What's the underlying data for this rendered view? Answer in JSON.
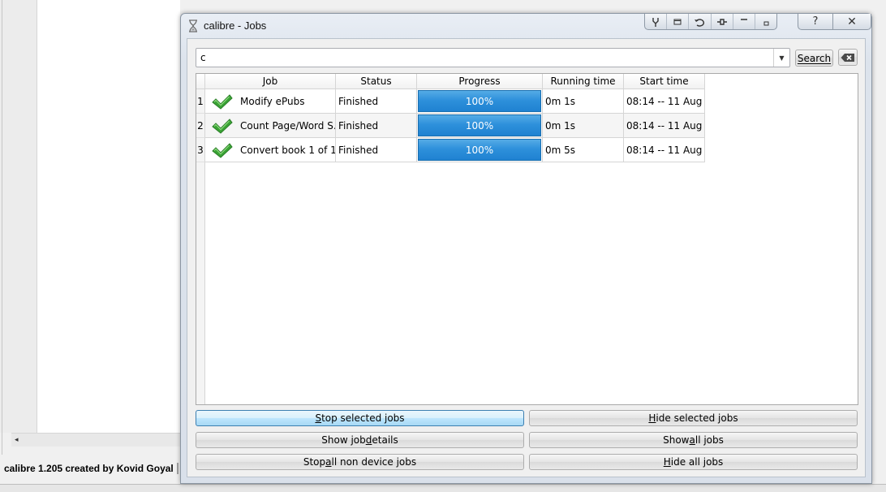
{
  "background": {
    "status_text": "calibre 1.205 created by Kovid Goyal",
    "scroll_left_arrow": "◂"
  },
  "dialog": {
    "title": "calibre - Jobs",
    "title_icon": "hourglass-icon",
    "help_label": "?",
    "close_label": "✕",
    "toolbar_icons": [
      "pin-icon",
      "restore-icon",
      "undo-icon",
      "plug-icon",
      "minimize-icon",
      "small-window-icon"
    ]
  },
  "search": {
    "value": "c",
    "button_label": "Search",
    "clear_icon": "clear-icon"
  },
  "table": {
    "columns": [
      "Job",
      "Status",
      "Progress",
      "Running time",
      "Start time"
    ],
    "rows": [
      {
        "num": "1",
        "job": "Modify ePubs",
        "status": "Finished",
        "progress": "100%",
        "running": "0m 1s",
        "start": "08:14 -- 11 Aug"
      },
      {
        "num": "2",
        "job": "Count Page/Word S...",
        "status": "Finished",
        "progress": "100%",
        "running": "0m 1s",
        "start": "08:14 -- 11 Aug"
      },
      {
        "num": "3",
        "job": "Convert book 1 of 1...",
        "status": "Finished",
        "progress": "100%",
        "running": "0m 5s",
        "start": "08:14 -- 11 Aug"
      }
    ]
  },
  "actions": {
    "stop_selected": {
      "pre": "",
      "key": "S",
      "post": "top selected jobs"
    },
    "hide_selected": {
      "pre": "",
      "key": "H",
      "post": "ide selected jobs"
    },
    "show_details": {
      "pre": "Show job ",
      "key": "d",
      "post": "etails"
    },
    "show_all": {
      "pre": "Show ",
      "key": "a",
      "post": "ll jobs"
    },
    "stop_all": {
      "pre": "Stop ",
      "key": "a",
      "post": "ll non device jobs"
    },
    "hide_all": {
      "pre": "",
      "key": "H",
      "post": "ide all jobs"
    }
  },
  "colors": {
    "progress_fill": "#2e90db",
    "check_green": "#3aa335",
    "focus_border": "#3c7fb1"
  }
}
